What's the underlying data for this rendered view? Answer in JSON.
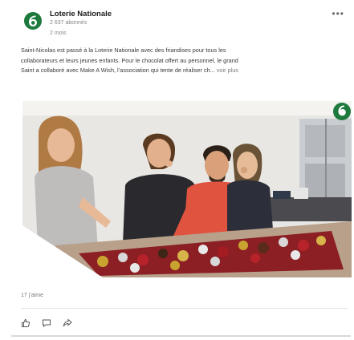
{
  "post": {
    "author": "Loterie Nationale",
    "followers": "2 637 abonnés",
    "time": "2 mois",
    "more_label": "•••",
    "text_lines": [
      "Saint-Nicolas est passé à la Loterie Nationale avec des friandises pour tous les",
      "collaborateurs et leurs jeunes enfants. Pour le chocolat offert au personnel, le grand",
      "Saint a collaboré avec Make A Wish, l’association qui tente de réaliser ch..."
    ],
    "see_more": "voir plus",
    "likes": "17 j’aime"
  },
  "icons": {
    "logo": "loterie-nationale-logo",
    "photo_logo": "loterie-nationale-logo",
    "like": "thumbs-up-icon",
    "comment": "comment-icon",
    "share": "share-icon"
  },
  "colors": {
    "brand_green": "#1e7a3c",
    "shirt_red": "#e0533f",
    "wall": "#e9e7e3"
  }
}
